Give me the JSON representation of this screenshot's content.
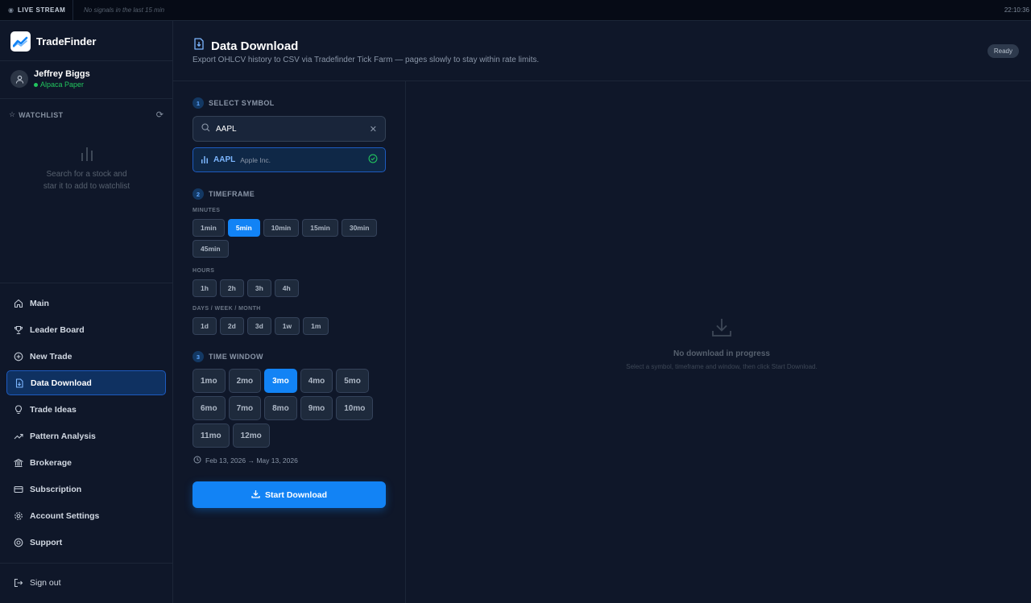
{
  "topbar": {
    "live_label": "LIVE STREAM",
    "signals_text": "No signals in the last 15 min",
    "time": "22:10:36"
  },
  "brand": {
    "name": "TradeFinder"
  },
  "user": {
    "name": "Jeffrey Biggs",
    "account": "Alpaca Paper"
  },
  "watchlist": {
    "title": "WATCHLIST",
    "empty_line1": "Search for a stock and",
    "empty_line2": "star it to add to watchlist"
  },
  "nav": {
    "items": [
      {
        "label": "Main",
        "icon": "home-icon"
      },
      {
        "label": "Leader Board",
        "icon": "trophy-icon"
      },
      {
        "label": "New Trade",
        "icon": "plus-circle-icon"
      },
      {
        "label": "Data Download",
        "icon": "file-download-icon",
        "active": true
      },
      {
        "label": "Trade Ideas",
        "icon": "lightbulb-icon"
      },
      {
        "label": "Pattern Analysis",
        "icon": "trending-up-icon"
      },
      {
        "label": "Brokerage",
        "icon": "bank-icon"
      },
      {
        "label": "Subscription",
        "icon": "credit-card-icon"
      },
      {
        "label": "Account Settings",
        "icon": "gear-icon"
      },
      {
        "label": "Support",
        "icon": "lifebuoy-icon"
      }
    ],
    "signout": "Sign out"
  },
  "header": {
    "title": "Data Download",
    "subtitle": "Export OHLCV history to CSV via Tradefinder Tick Farm — pages slowly to stay within rate limits.",
    "status": "Ready"
  },
  "form": {
    "step1": {
      "num": "1",
      "label": "SELECT SYMBOL"
    },
    "search_value": "AAPL",
    "result": {
      "symbol": "AAPL",
      "name": "Apple Inc."
    },
    "step2": {
      "num": "2",
      "label": "TIMEFRAME"
    },
    "minutes_label": "MINUTES",
    "minutes": [
      "1min",
      "5min",
      "10min",
      "15min",
      "30min",
      "45min"
    ],
    "minutes_selected": "5min",
    "hours_label": "HOURS",
    "hours": [
      "1h",
      "2h",
      "3h",
      "4h"
    ],
    "days_label": "DAYS / WEEK / MONTH",
    "days": [
      "1d",
      "2d",
      "3d",
      "1w",
      "1m"
    ],
    "step3": {
      "num": "3",
      "label": "TIME WINDOW"
    },
    "windows": [
      "1mo",
      "2mo",
      "3mo",
      "4mo",
      "5mo",
      "6mo",
      "7mo",
      "8mo",
      "9mo",
      "10mo",
      "11mo",
      "12mo"
    ],
    "window_selected": "3mo",
    "date_range": "Feb 13, 2026 → May 13, 2026",
    "start_label": "Start Download"
  },
  "empty": {
    "title": "No download in progress",
    "subtitle": "Select a symbol, timeframe and window, then click Start Download."
  },
  "colors": {
    "accent": "#1283f5",
    "success": "#22c55e",
    "background": "#0f1729"
  }
}
